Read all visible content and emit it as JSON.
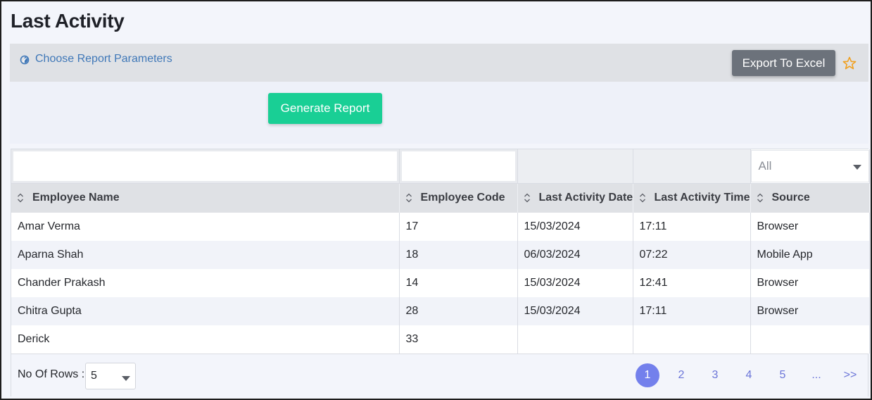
{
  "title": "Last Activity",
  "parameters": {
    "link_label": "Choose Report Parameters"
  },
  "toolbar": {
    "export_label": "Export To Excel"
  },
  "generate": {
    "label": "Generate Report"
  },
  "filters": {
    "source_selected": "All"
  },
  "table": {
    "columns": [
      "Employee Name",
      "Employee Code",
      "Last Activity Date",
      "Last Activity Time",
      "Source"
    ],
    "rows": [
      [
        "Amar Verma",
        "17",
        "15/03/2024",
        "17:11",
        "Browser"
      ],
      [
        "Aparna Shah",
        "18",
        "06/03/2024",
        "07:22",
        "Mobile App"
      ],
      [
        "Chander Prakash",
        "14",
        "15/03/2024",
        "12:41",
        "Browser"
      ],
      [
        "Chitra Gupta",
        "28",
        "15/03/2024",
        "17:11",
        "Browser"
      ],
      [
        "Derick",
        "33",
        "",
        "",
        ""
      ]
    ]
  },
  "footer": {
    "rows_label": "No Of Rows :",
    "rows_value": "5",
    "pages": [
      "1",
      "2",
      "3",
      "4",
      "5",
      "...",
      ">>"
    ],
    "active_page": "1"
  },
  "colors": {
    "accent_green": "#19cf95",
    "export_grey": "#6c727b",
    "link_blue": "#4078b8",
    "pager_active": "#7380ec",
    "star": "#f0a020"
  },
  "icons": {
    "params": "settings-dial-icon",
    "favorite": "star-outline-icon",
    "sort": "sort-updown-icon",
    "dropdown": "caret-down-icon"
  }
}
